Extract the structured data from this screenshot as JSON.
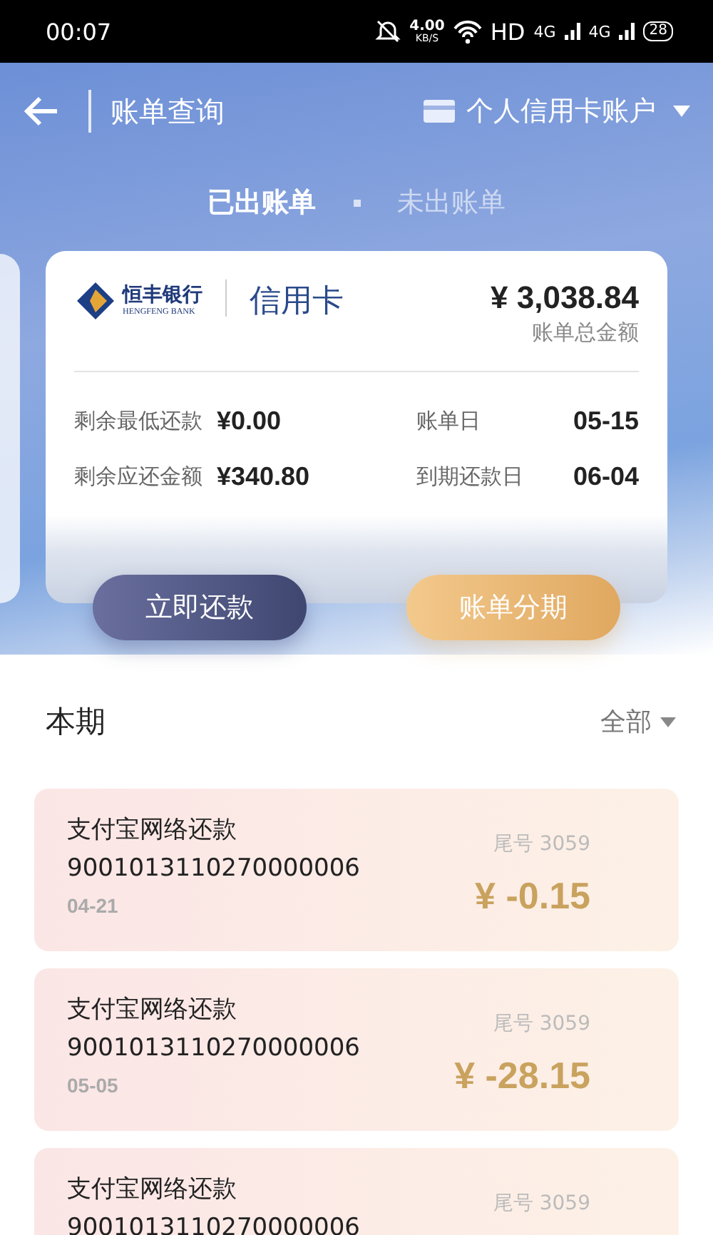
{
  "status_bar": {
    "time": "00:07",
    "speed": "4.00",
    "speed_unit": "KB/S",
    "hd": "HD",
    "network_1": "4G",
    "network_2": "4G",
    "battery": "28"
  },
  "nav": {
    "title": "账单查询",
    "account": "个人信用卡账户"
  },
  "tabs": [
    {
      "label": "已出账单",
      "selected": true
    },
    {
      "label": "未出账单",
      "selected": false
    }
  ],
  "card": {
    "bank_name": "恒丰银行",
    "bank_name_en": "HENGFENG BANK",
    "card_type": "信用卡",
    "total": "¥ 3,038.84",
    "total_label": "账单总金额",
    "details": [
      {
        "label": "剩余最低还款",
        "value": "¥0.00"
      },
      {
        "label": "账单日",
        "value": "05-15"
      },
      {
        "label": "剩余应还金额",
        "value": "¥340.80"
      },
      {
        "label": "到期还款日",
        "value": "06-04"
      }
    ]
  },
  "actions": [
    {
      "label": "立即还款",
      "kind": "primary"
    },
    {
      "label": "账单分期",
      "kind": "secondary"
    }
  ],
  "section": {
    "title": "本期",
    "filter": "全部"
  },
  "transactions": [
    {
      "title": "支付宝网络还款",
      "number": "9001013110270000006",
      "date": "04-21",
      "card_tail": "尾号 3059",
      "amount": "¥ -0.15"
    },
    {
      "title": "支付宝网络还款",
      "number": "9001013110270000006",
      "date": "05-05",
      "card_tail": "尾号 3059",
      "amount": "¥ -28.15"
    },
    {
      "title": "支付宝网络还款",
      "number": "9001013110270000006",
      "card_tail": "尾号 3059"
    }
  ]
}
